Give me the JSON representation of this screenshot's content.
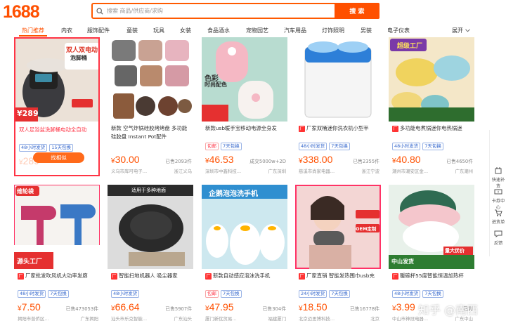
{
  "header": {
    "logo": "1688",
    "search_placeholder": "搜索 商品/供应商/求购",
    "search_button": "搜 索"
  },
  "categories": {
    "items": [
      "热门推荐",
      "内衣",
      "服饰配件",
      "童装",
      "玩具",
      "女装",
      "食品酒水",
      "宠物园艺",
      "汽车用品",
      "灯饰照明",
      "男装",
      "电子仪表"
    ],
    "expand": "展开",
    "active_index": 0
  },
  "products": [
    {
      "title": "双人足浴盆洗脚桶电动全自动",
      "tags": [
        "48小时发货",
        "15天包换"
      ],
      "price": "289",
      "sold": "",
      "location": "",
      "shop": "",
      "button": "找相似",
      "selected": true,
      "thumb_text": "双人双电动",
      "thumb_sub": "泡脚桶",
      "thumb_price": "¥289"
    },
    {
      "title": "新款 空气炸锅硅胶烤烤盘 多功能硅胶盘 Instant Pot配件",
      "tags": [],
      "price": "30.00",
      "sold": "已售2093件",
      "location": "浙江义乌",
      "shop": "义乌市库可电子…",
      "button": "",
      "selected": false
    },
    {
      "title": "新款usb暖手宝移动电源全身发",
      "tags": [
        "包邮",
        "7天包换"
      ],
      "price": "46.53",
      "sold": "成交5000w+2D",
      "location": "广东深圳",
      "shop": "深圳市中鑫科技…",
      "button": "",
      "selected": false,
      "thumb_text": "色彩",
      "thumb_sub": "时尚配色"
    },
    {
      "title": "厂家双桶迷你洗衣机小型半",
      "tags": [
        "48小时发货",
        "7天包换"
      ],
      "price": "338.00",
      "sold": "已售2355件",
      "location": "浙江宁波",
      "shop": "慈溪市尚家电器…",
      "button": "",
      "selected": false
    },
    {
      "title": "多功能电煮锅迷你电热锅迷",
      "tags": [
        "48小时发货",
        "7天包换"
      ],
      "price": "40.80",
      "sold": "已售4650件",
      "location": "广东潮州",
      "shop": "潮州市潮安区金…",
      "button": "",
      "selected": false,
      "thumb_text": "超级工厂"
    },
    {
      "title": "厂家批发吹风机大功率发廊",
      "tags": [
        "48小时发货",
        "7天包换"
      ],
      "price": "7.50",
      "sold": "已售473053件",
      "location": "广东揭阳",
      "shop": "揭阳市普侨区…",
      "button": "",
      "selected": false,
      "thumb_text": "维轮袋",
      "thumb_sub": "源头工厂"
    },
    {
      "title": "智能扫地机器人 吸尘器家",
      "tags": [
        "48小时发货"
      ],
      "price": "66.64",
      "sold": "已售5907件",
      "location": "广东汕头",
      "shop": "汕头市乐克智能…",
      "button": "",
      "selected": false,
      "thumb_text": "适用于多种地面"
    },
    {
      "title": "新款自动感应泡沫洗手机",
      "tags": [
        "包邮",
        "7天包换"
      ],
      "price": "47.95",
      "sold": "已售304件",
      "location": "福建厦门",
      "shop": "厦门新优贸易…",
      "button": "",
      "selected": false,
      "thumb_text": "企鹅泡泡洗手机"
    },
    {
      "title": "厂家直销 智能发热围巾usb充",
      "tags": [
        "24小时发货",
        "7天包换"
      ],
      "price": "18.50",
      "sold": "已售16778件",
      "location": "北京",
      "shop": "北京迈思博科技…",
      "button": "",
      "selected": false,
      "thumb_text": "OEM定制"
    },
    {
      "title": "暖碗杯55度智能恒温加热杯",
      "tags": [
        "48小时发货",
        "7天包换"
      ],
      "price": "3.99",
      "sold": "已售",
      "location": "广东中山",
      "shop": "中山市神冠电器…",
      "button": "",
      "selected": false,
      "thumb_text": "中山发货",
      "thumb_sub": "量大优价"
    }
  ],
  "sidebar": {
    "items": [
      "快速补货",
      "卡券中心",
      "进货单",
      "反馈"
    ]
  },
  "watermark": "知乎 @南西",
  "colors": {
    "accent": "#ff5000",
    "tag_blue": "#3366cc",
    "tag_red": "#ff3344"
  }
}
